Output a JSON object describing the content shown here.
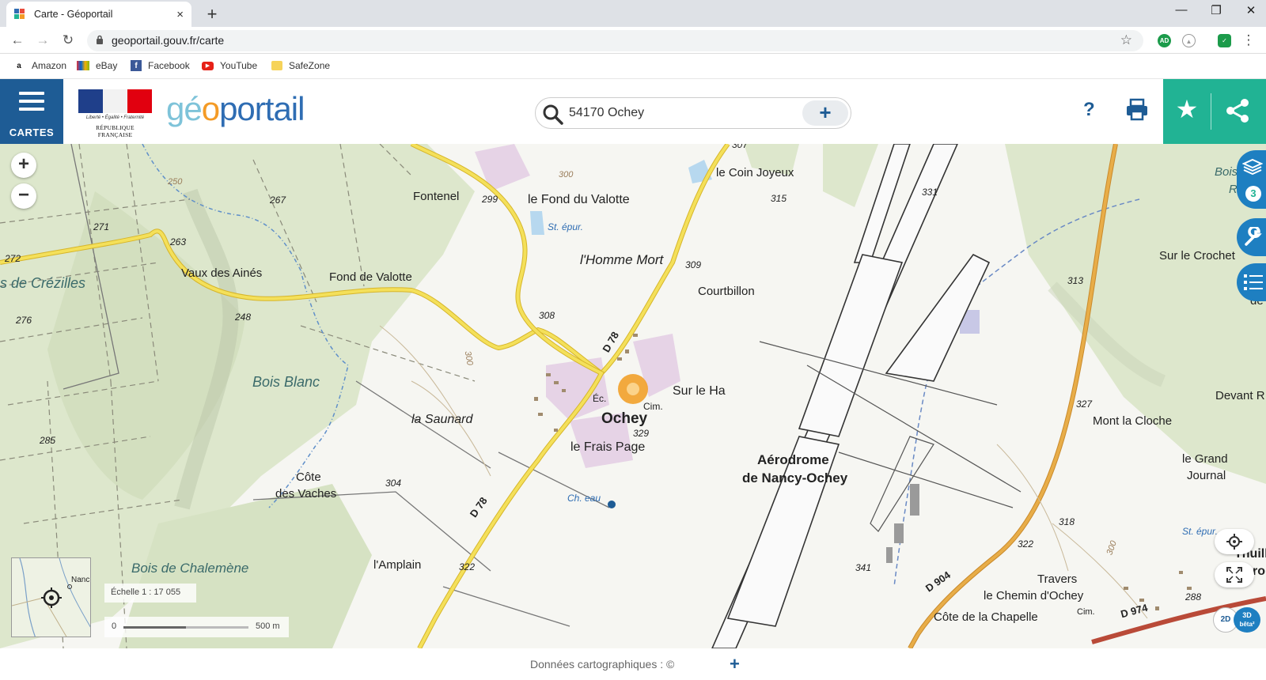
{
  "browser": {
    "tab_title": "Carte - Géoportail",
    "tab_close": "×",
    "new_tab": "+",
    "url": "geoportail.gouv.fr/carte",
    "window_minimize": "—",
    "window_restore": "❐",
    "window_close": "✕",
    "bookmarks": [
      {
        "label": "Amazon",
        "icon": "amazon-icon"
      },
      {
        "label": "eBay",
        "icon": "ebay-icon"
      },
      {
        "label": "Facebook",
        "icon": "facebook-icon"
      },
      {
        "label": "YouTube",
        "icon": "youtube-icon"
      },
      {
        "label": "SafeZone",
        "icon": "folder-icon"
      }
    ],
    "extensions": [
      "AD"
    ]
  },
  "header": {
    "menu_label": "CARTES",
    "republique_motto": "Liberté • Égalité • Fraternité",
    "republique_name": "RÉPUBLIQUE FRANÇAISE",
    "logo_geo": "gé",
    "logo_o": "o",
    "logo_portail": "portail",
    "search_value": "54170 Ochey",
    "search_plus": "+",
    "help_label": "?",
    "colors": {
      "primary": "#1e5c95",
      "accent": "#21b394",
      "logo_light": "#7ec3d9",
      "logo_orange": "#f49b26"
    }
  },
  "map": {
    "zoom_in": "+",
    "zoom_out": "−",
    "layers_count": "3",
    "scale_text": "Échelle 1 : 17 055",
    "scale_bar_start": "0",
    "scale_bar_end": "500 m",
    "minimap_label": "Nanc",
    "view_2d": "2D",
    "view_3d": "3D",
    "view_beta": "bêta²",
    "labels": {
      "fontenel": "Fontenel",
      "fond_valotte_top": "le Fond du Valotte",
      "st_epur": "St. épur.",
      "homme_mort": "l'Homme Mort",
      "coin_joyeux": "le Coin Joyeux",
      "courtbillon": "Courtbillon",
      "vaux_aines": "Vaux des Ainés",
      "fond_valotte": "Fond de Valotte",
      "crezilles": "s de Crézilles",
      "bois_blanc": "Bois Blanc",
      "la_saunard": "la Saunard",
      "ochey": "Ochey",
      "sur_le_ha": "Sur le Ha",
      "frais_page": "le Frais Page",
      "cote_vaches_1": "Côte",
      "cote_vaches_2": "des Vaches",
      "ch_eau": "Ch. eau",
      "aerodrome_1": "Aérodrome",
      "aerodrome_2": "de Nancy-Ochey",
      "bois_chalemene": "Bois de Chalemène",
      "l_amplain": "l'Amplain",
      "d78_top": "D 78",
      "d78_bottom": "D 78",
      "ec": "Éc.",
      "cim": "Cim.",
      "bois_du_me": "Bois du Me",
      "rouge": "Roug",
      "sur_le_crochet": "Sur le Crochet",
      "de": "de",
      "devant_r": "Devant R",
      "mont_la_cloche": "Mont la Cloche",
      "grand_journal_1": "le Grand",
      "grand_journal_2": "Journal",
      "st_epur_right": "St. épur.",
      "travers": "Travers",
      "chemin_ochey": "le Chemin d'Ochey",
      "cote_chapelle": "Côte de la Chapelle",
      "d904": "D 904",
      "d974": "D 974",
      "cim_right": "Cim.",
      "thuill": "Thuill",
      "ro": "ro"
    },
    "elevations": {
      "e307": "307",
      "e300a": "300",
      "e299": "299",
      "e315": "315",
      "e331": "331",
      "e267": "267",
      "e250": "250",
      "e271": "271",
      "e263": "263",
      "e272": "272",
      "e309": "309",
      "e308": "308",
      "e248": "248",
      "e276": "276",
      "e300b": "300",
      "e313": "313",
      "e327": "327",
      "e285": "285",
      "e329": "329",
      "e304": "304",
      "e322a": "322",
      "e341": "341",
      "e318": "318",
      "e322b": "322",
      "e288": "288",
      "e300c": "300"
    }
  },
  "footer": {
    "text": "Données cartographiques : ©",
    "plus": "+"
  }
}
